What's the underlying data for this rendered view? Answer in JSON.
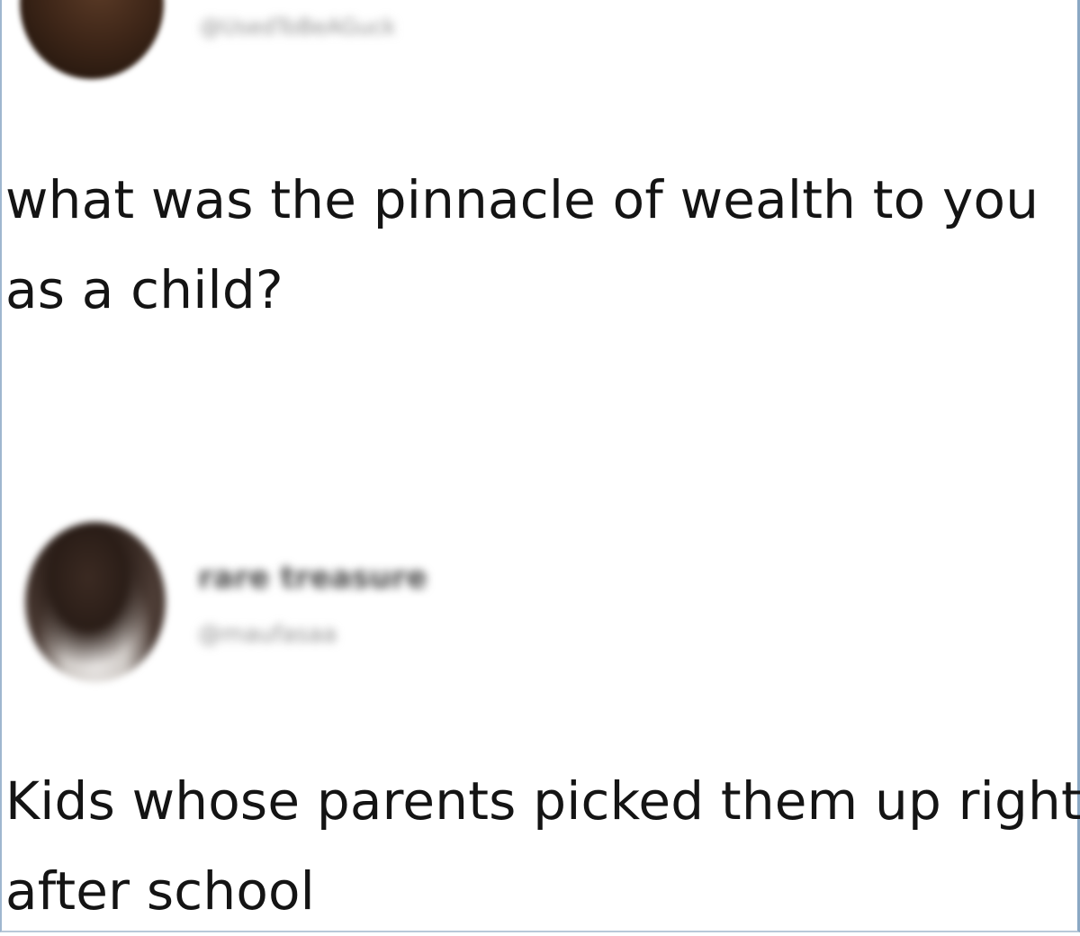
{
  "tweets": {
    "question": {
      "author_handle": "@UsedToBeAGuck",
      "text": "what was the pinnacle of wealth to you as a child?"
    },
    "reply": {
      "author_name": "rare treasure",
      "author_handle": "@maufasaa",
      "text": "Kids whose parents picked them up right after school"
    }
  }
}
